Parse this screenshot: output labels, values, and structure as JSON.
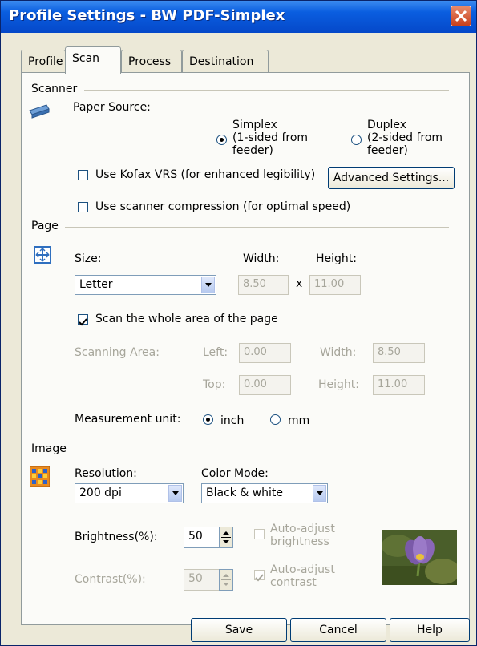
{
  "window": {
    "title": "Profile Settings - BW PDF-Simplex"
  },
  "tabs": [
    "Profile",
    "Scan",
    "Process",
    "Destination"
  ],
  "scanner": {
    "section": "Scanner",
    "paper_source_label": "Paper Source:",
    "simplex": "Simplex\n(1-sided from\nfeeder)",
    "duplex": "Duplex\n(2-sided from\nfeeder)",
    "use_kofax": "Use Kofax VRS (for enhanced legibility)",
    "advanced": "Advanced Settings...",
    "use_compression": "Use scanner compression (for optimal speed)"
  },
  "page": {
    "section": "Page",
    "size_label": "Size:",
    "size_value": "Letter",
    "width_label": "Width:",
    "height_label": "Height:",
    "width_value": "8.50",
    "x": "x",
    "height_value": "11.00",
    "scan_whole": "Scan the whole area of the page",
    "scanning_area": "Scanning Area:",
    "left_label": "Left:",
    "left_value": "0.00",
    "area_width_label": "Width:",
    "area_width_value": "8.50",
    "top_label": "Top:",
    "top_value": "0.00",
    "area_height_label": "Height:",
    "area_height_value": "11.00",
    "measurement_label": "Measurement unit:",
    "inch": "inch",
    "mm": "mm"
  },
  "image": {
    "section": "Image",
    "resolution_label": "Resolution:",
    "resolution_value": "200 dpi",
    "color_mode_label": "Color Mode:",
    "color_mode_value": "Black & white",
    "brightness_label": "Brightness(%):",
    "brightness_value": "50",
    "auto_brightness": "Auto-adjust\nbrightness",
    "contrast_label": "Contrast(%):",
    "contrast_value": "50",
    "auto_contrast": "Auto-adjust\ncontrast"
  },
  "buttons": {
    "save": "Save",
    "cancel": "Cancel",
    "help": "Help"
  }
}
